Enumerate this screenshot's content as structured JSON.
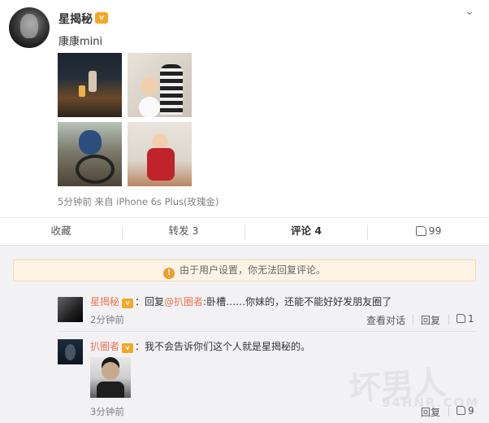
{
  "post": {
    "author": "星揭秘",
    "vip_badge": "v",
    "text": "康康mini",
    "meta": "5分钟前 来自 iPhone 6s Plus(玫瑰金)",
    "photos": [
      "photo-night-beach",
      "photo-boy-and-girl",
      "photo-boy-on-bike",
      "photo-boy-red-jacket"
    ]
  },
  "actions": {
    "favorite": "收藏",
    "repost": "转发 3",
    "comment": "评论 4",
    "like": "99"
  },
  "notice": {
    "text": "由于用户设置，你无法回复评论。",
    "icon_glyph": "!"
  },
  "comments": [
    {
      "author": "星揭秘",
      "vip_badge": "v",
      "reply_prefix": "：回复",
      "mention": "@扒圈者",
      "body": ":卧槽……你妹的，还能不能好好发朋友圈了",
      "time": "2分钟前",
      "view_dialog": "查看对话",
      "reply": "回复",
      "likes": "1"
    },
    {
      "author": "扒圈者",
      "vip_badge": "v",
      "body": "：我不会告诉你们这个人就是星揭秘的。",
      "time": "3分钟前",
      "reply": "回复",
      "likes": "9"
    }
  ],
  "watermark": {
    "main": "坏男人",
    "sub": "94HNR.COM"
  },
  "colors": {
    "accent": "#eb7350",
    "vip": "#f5a623",
    "notice_bg": "#fdf4e6"
  }
}
